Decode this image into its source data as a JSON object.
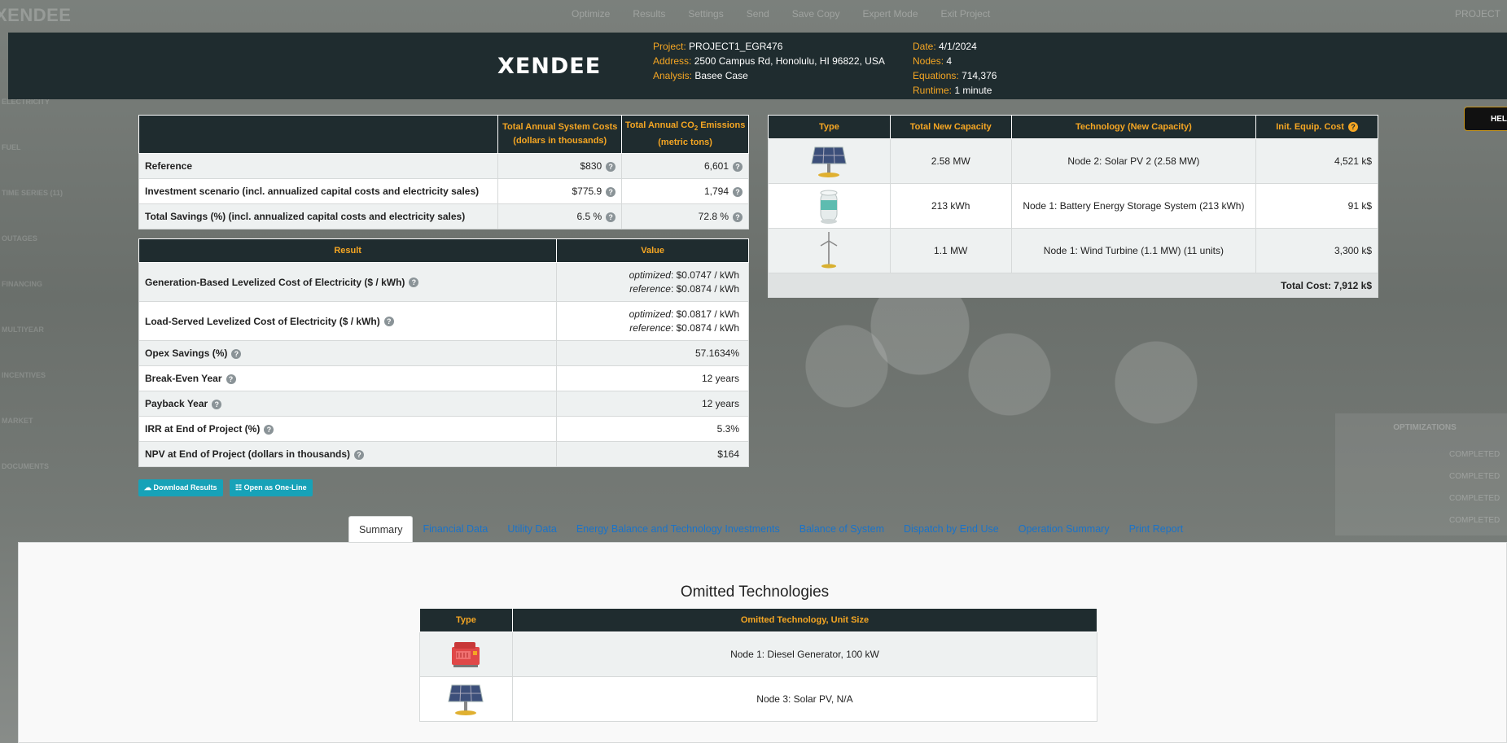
{
  "background": {
    "logo": "XENDEE",
    "nav": [
      "Optimize",
      "Results",
      "Settings",
      "Send",
      "Save Copy",
      "Expert Mode",
      "Exit Project"
    ],
    "project": "PROJECT",
    "sidebar": [
      "ELECTRICITY",
      "FUEL",
      "TIME SERIES (11)",
      "OUTAGES",
      "FINANCING",
      "MULTIYEAR",
      "INCENTIVES",
      "MARKET",
      "DOCUMENTS"
    ],
    "help": "HEL",
    "optimizations_title": "OPTIMIZATIONS",
    "optimizations": [
      "COMPLETED",
      "COMPLETED",
      "COMPLETED",
      "COMPLETED"
    ]
  },
  "header": {
    "logo": "XENDEE",
    "project_label": "Project:",
    "project": "PROJECT1_EGR476",
    "address_label": "Address:",
    "address": "2500 Campus Rd, Honolulu, HI 96822, USA",
    "analysis_label": "Analysis:",
    "analysis": "Basee Case",
    "date_label": "Date:",
    "date": "4/1/2024",
    "nodes_label": "Nodes:",
    "nodes": "4",
    "equations_label": "Equations:",
    "equations": "714,376",
    "runtime_label": "Runtime:",
    "runtime": "1 minute"
  },
  "summary": {
    "col_costs_1": "Total Annual System Costs",
    "col_costs_2": "(dollars in thousands)",
    "col_co2_1a": "Total Annual CO",
    "col_co2_sub": "2",
    "col_co2_1b": " Emissions",
    "col_co2_2": "(metric tons)",
    "rows": [
      {
        "label": "Reference",
        "cost": "$830",
        "co2": "6,601"
      },
      {
        "label": "Investment scenario (incl. annualized capital costs and electricity sales)",
        "cost": "$775.9",
        "co2": "1,794"
      },
      {
        "label": "Total Savings (%) (incl. annualized capital costs and electricity sales)",
        "cost": "6.5 %",
        "co2": "72.8 %"
      }
    ]
  },
  "results": {
    "col_result": "Result",
    "col_value": "Value",
    "optimized_label": "optimized",
    "reference_label": "reference",
    "gen_lcoe_label": "Generation-Based Levelized Cost of Electricity ($ / kWh)",
    "gen_lcoe_opt": ": $0.0747 / kWh",
    "gen_lcoe_ref": ": $0.0874 / kWh",
    "load_lcoe_label": "Load-Served Levelized Cost of Electricity ($ / kWh)",
    "load_lcoe_opt": ": $0.0817 / kWh",
    "load_lcoe_ref": ": $0.0874 / kWh",
    "rows": [
      {
        "label": "Opex Savings (%)",
        "value": "57.1634%"
      },
      {
        "label": "Break-Even Year",
        "value": "12 years"
      },
      {
        "label": "Payback Year",
        "value": "12 years"
      },
      {
        "label": "IRR at End of Project (%)",
        "value": "5.3%"
      },
      {
        "label": "NPV at End of Project (dollars in thousands)",
        "value": "$164"
      }
    ]
  },
  "buttons": {
    "download": "Download Results",
    "oneline": "Open as One-Line"
  },
  "tech": {
    "col_type": "Type",
    "col_capacity": "Total New Capacity",
    "col_tech": "Technology (New Capacity)",
    "col_cost": "Init. Equip. Cost",
    "rows": [
      {
        "icon": "solar-panel-icon",
        "capacity": "2.58 MW",
        "tech": "Node 2: Solar PV 2 (2.58 MW)",
        "cost": "4,521 k$"
      },
      {
        "icon": "battery-icon",
        "capacity": "213 kWh",
        "tech": "Node 1: Battery Energy Storage System (213 kWh)",
        "cost": "91 k$"
      },
      {
        "icon": "wind-turbine-icon",
        "capacity": "1.1 MW",
        "tech": "Node 1: Wind Turbine (1.1 MW) (11 units)",
        "cost": "3,300 k$"
      }
    ],
    "total": "Total Cost: 7,912 k$"
  },
  "tabs": [
    "Summary",
    "Financial Data",
    "Utility Data",
    "Energy Balance and Technology Investments",
    "Balance of System",
    "Dispatch by End Use",
    "Operation Summary",
    "Print Report"
  ],
  "omitted": {
    "title": "Omitted Technologies",
    "col_type": "Type",
    "col_tech": "Omitted Technology, Unit Size",
    "rows": [
      {
        "icon": "diesel-generator-icon",
        "tech": "Node 1: Diesel Generator, 100 kW"
      },
      {
        "icon": "solar-panel-icon",
        "tech": "Node 3: Solar PV, N/A"
      }
    ]
  },
  "colors": {
    "header_bg": "#1f2c2f",
    "accent": "#f5a623",
    "link": "#1a73c9",
    "button": "#17a2b8"
  }
}
